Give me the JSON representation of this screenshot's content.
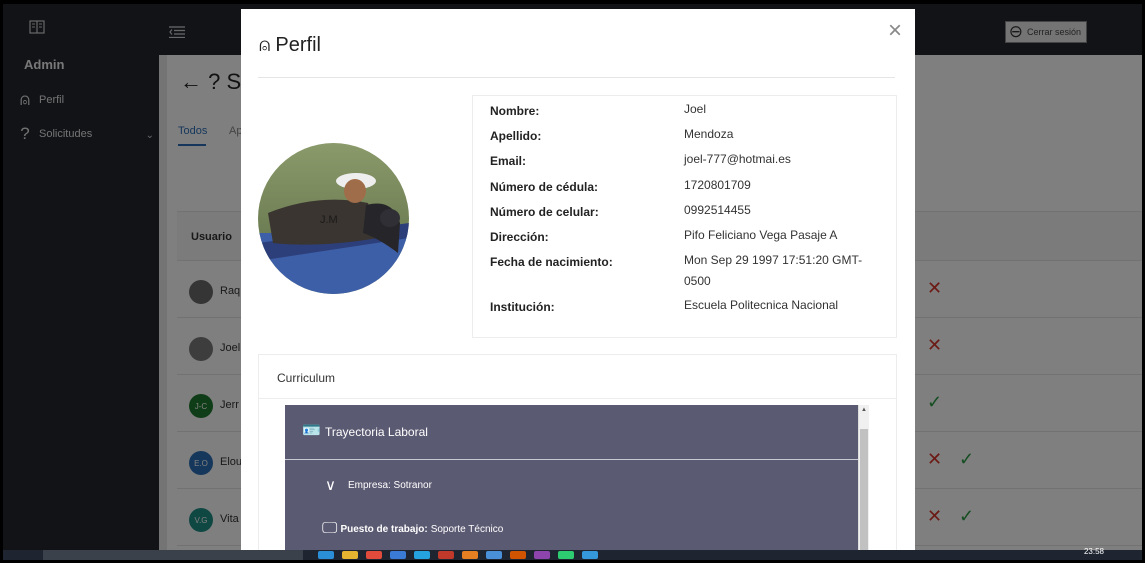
{
  "sidebar": {
    "title": "Admin",
    "items": [
      {
        "icon": "user-icon",
        "label": "Perfil"
      },
      {
        "icon": "question-icon",
        "label": "Solicitudes"
      }
    ]
  },
  "header": {
    "logout_label": "Cerrar sesión"
  },
  "background_page": {
    "title_fragment": "? S",
    "tabs": [
      "Todos",
      "Ap"
    ],
    "table_header": "Usuario",
    "rows": [
      {
        "initials": "",
        "name": "Raq",
        "avatar_color": "#6b6b6b"
      },
      {
        "initials": "",
        "name": "Joel",
        "avatar_color": "#7a7a7a"
      },
      {
        "initials": "J-C",
        "name": "Jerr",
        "avatar_color": "#1f7a2e"
      },
      {
        "initials": "E.O",
        "name": "Elou",
        "avatar_color": "#2a6fb8"
      },
      {
        "initials": "V.G",
        "name": "Vita",
        "avatar_color": "#1f8f86"
      }
    ]
  },
  "modal": {
    "title": "Perfil",
    "close_label": "×",
    "photo_caption": "J.M",
    "profile": [
      {
        "label": "Nombre:",
        "value": "Joel"
      },
      {
        "label": "Apellido:",
        "value": "Mendoza"
      },
      {
        "label": "Email:",
        "value": "joel-777@hotmai.es"
      },
      {
        "label": "Número de cédula:",
        "value": "1720801709"
      },
      {
        "label": "Número de celular:",
        "value": "0992514455"
      },
      {
        "label": "Dirección:",
        "value": "Pifo Feliciano Vega Pasaje A"
      },
      {
        "label": "Fecha de nacimiento:",
        "value": "Mon Sep 29 1997 17:51:20 GMT-0500"
      },
      {
        "label": "Institución:",
        "value": "Escuela Politecnica Nacional"
      }
    ],
    "curriculum_label": "Curriculum",
    "trajectory_title": "Trayectoria Laboral",
    "company": "Empresa: Sotranor",
    "position_label": "Puesto de trabajo:",
    "position_value": "Soporte Técnico"
  },
  "taskbar": {
    "clock": "23:58"
  },
  "colors": {
    "sidebar_bg": "#22272e",
    "accent_blue": "#2c6fb7",
    "trajectory_bg": "#5b5a73",
    "reject_red": "#d9342b",
    "approve_green": "#2a9d45"
  }
}
